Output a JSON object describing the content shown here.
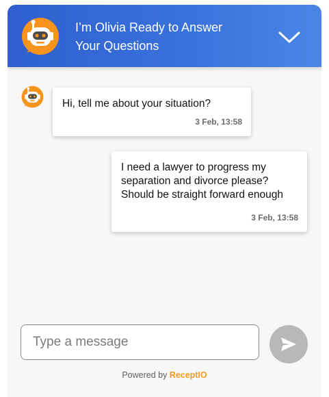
{
  "header": {
    "title_line1": "I’m Olivia Ready to Answer",
    "title_line2": "Your Questions",
    "avatar_icon": "robot-icon",
    "collapse_icon": "chevron-down-icon",
    "gradient_start": "#2f5fcf",
    "gradient_end": "#4a86e6"
  },
  "messages": [
    {
      "sender": "bot",
      "text": "Hi, tell me about your situation?",
      "time": "3 Feb, 13:58"
    },
    {
      "sender": "user",
      "text": "I need a lawyer to progress my separation and divorce please? Should be straight forward enough",
      "time": "3 Feb, 13:58"
    }
  ],
  "composer": {
    "placeholder": "Type a message",
    "value": "",
    "send_icon": "send-icon"
  },
  "footer": {
    "powered_prefix": "Powered by ",
    "brand": "ReceptIO",
    "brand_color": "#f29a1e"
  },
  "colors": {
    "bot_orange": "#f7941d",
    "send_button": "#b8b8b8"
  }
}
